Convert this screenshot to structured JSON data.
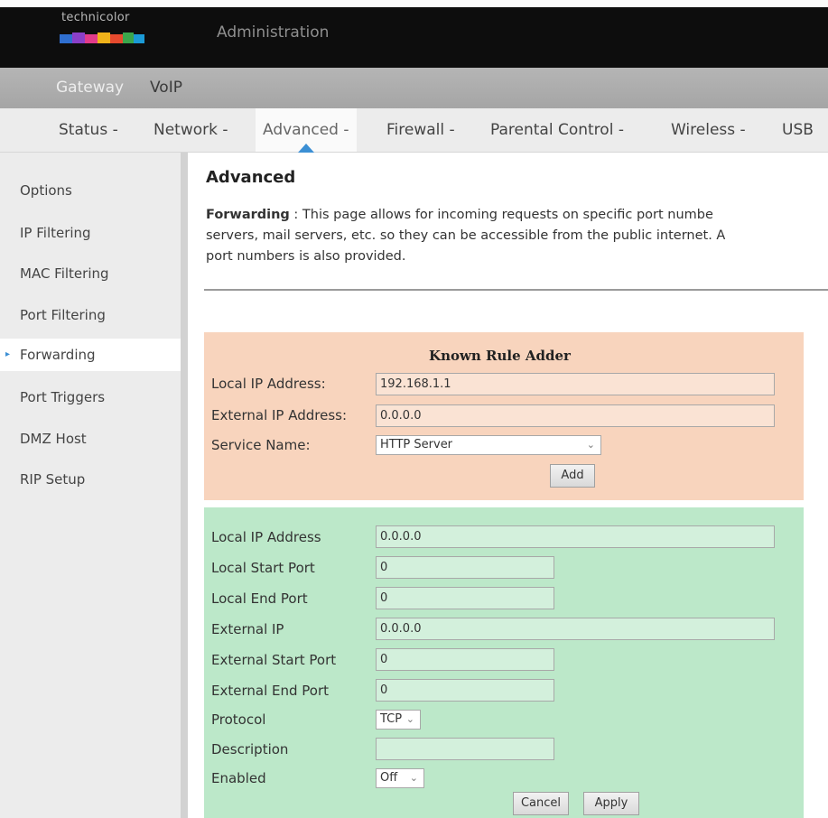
{
  "header": {
    "brand": "technicolor",
    "title": "Administration"
  },
  "subnav": {
    "items": [
      "Gateway",
      "VoIP"
    ]
  },
  "mainnav": {
    "items": [
      "Status -",
      "Network -",
      "Advanced -",
      "Firewall -",
      "Parental Control -",
      "Wireless -",
      "USB"
    ],
    "active": "Advanced -"
  },
  "sidebar": {
    "items": [
      "Options",
      "IP Filtering",
      "MAC Filtering",
      "Port Filtering",
      "Forwarding",
      "Port Triggers",
      "DMZ Host",
      "RIP Setup"
    ],
    "active": "Forwarding"
  },
  "page": {
    "title": "Advanced",
    "desc_bold": "Forwarding",
    "desc_line1": " : This page allows for incoming requests on specific port numbe",
    "desc_line2": "servers, mail servers, etc. so they can be accessible from the public internet. A",
    "desc_line3": "port numbers is also provided."
  },
  "known_rule_adder": {
    "title": "Known Rule Adder",
    "local_ip_label": "Local IP Address:",
    "local_ip_value": "192.168.1.1",
    "external_ip_label": "External IP Address:",
    "external_ip_value": "0.0.0.0",
    "service_label": "Service Name:",
    "service_value": "HTTP Server",
    "add_label": "Add"
  },
  "rule_form": {
    "local_ip_label": "Local IP Address",
    "local_ip_value": "0.0.0.0",
    "local_start_label": "Local Start Port",
    "local_start_value": "0",
    "local_end_label": "Local End Port",
    "local_end_value": "0",
    "external_ip_label": "External IP",
    "external_ip_value": "0.0.0.0",
    "external_start_label": "External Start Port",
    "external_start_value": "0",
    "external_end_label": "External End Port",
    "external_end_value": "0",
    "protocol_label": "Protocol",
    "protocol_value": "TCP",
    "description_label": "Description",
    "description_value": "",
    "enabled_label": "Enabled",
    "enabled_value": "Off",
    "cancel_label": "Cancel",
    "apply_label": "Apply"
  },
  "colors": {
    "header_bg": "#0d0d0d",
    "subnav_bg": "#aaaaaa",
    "accent": "#3b8fd4",
    "orange_panel": "#f8d4bd",
    "green_panel": "#bce8c9"
  }
}
